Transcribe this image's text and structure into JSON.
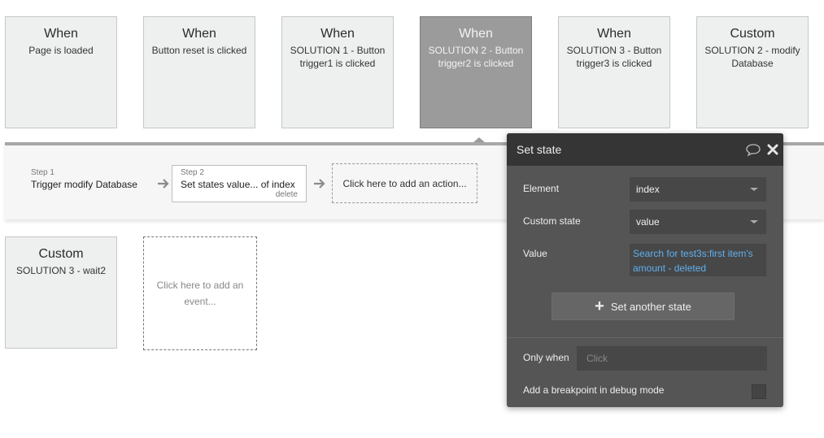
{
  "events": [
    {
      "type": "When",
      "description": "Page is loaded"
    },
    {
      "type": "When",
      "description": "Button reset is clicked"
    },
    {
      "type": "When",
      "description": "SOLUTION 1 - Button trigger1 is clicked"
    },
    {
      "type": "When",
      "description": "SOLUTION 2 - Button trigger2 is clicked"
    },
    {
      "type": "When",
      "description": "SOLUTION 3 - Button trigger3 is clicked"
    },
    {
      "type": "Custom",
      "description": "SOLUTION 2 - modify Database"
    },
    {
      "type": "Custom",
      "description": "SOLUTION 3 - wait2"
    }
  ],
  "add_event_label": "Click here to add an event...",
  "workflow": {
    "steps": [
      {
        "number": "Step 1",
        "name": "Trigger modify Database"
      },
      {
        "number": "Step 2",
        "name": "Set states value... of index",
        "delete_label": "delete"
      }
    ],
    "add_action_label": "Click here to add an action..."
  },
  "panel": {
    "title": "Set state",
    "element_label": "Element",
    "element_value": "index",
    "custom_state_label": "Custom state",
    "custom_state_value": "value",
    "value_label": "Value",
    "value_expression": "Search for test3s:first item's amount - deleted",
    "set_another_label": "Set another state",
    "only_when_label": "Only when",
    "only_when_placeholder": "Click",
    "breakpoint_label": "Add a breakpoint in debug mode"
  },
  "colors": {
    "selected_card": "#9b9b9b",
    "panel_background": "#555555",
    "panel_header": "#353535",
    "expression_text": "#5fb0f0"
  }
}
